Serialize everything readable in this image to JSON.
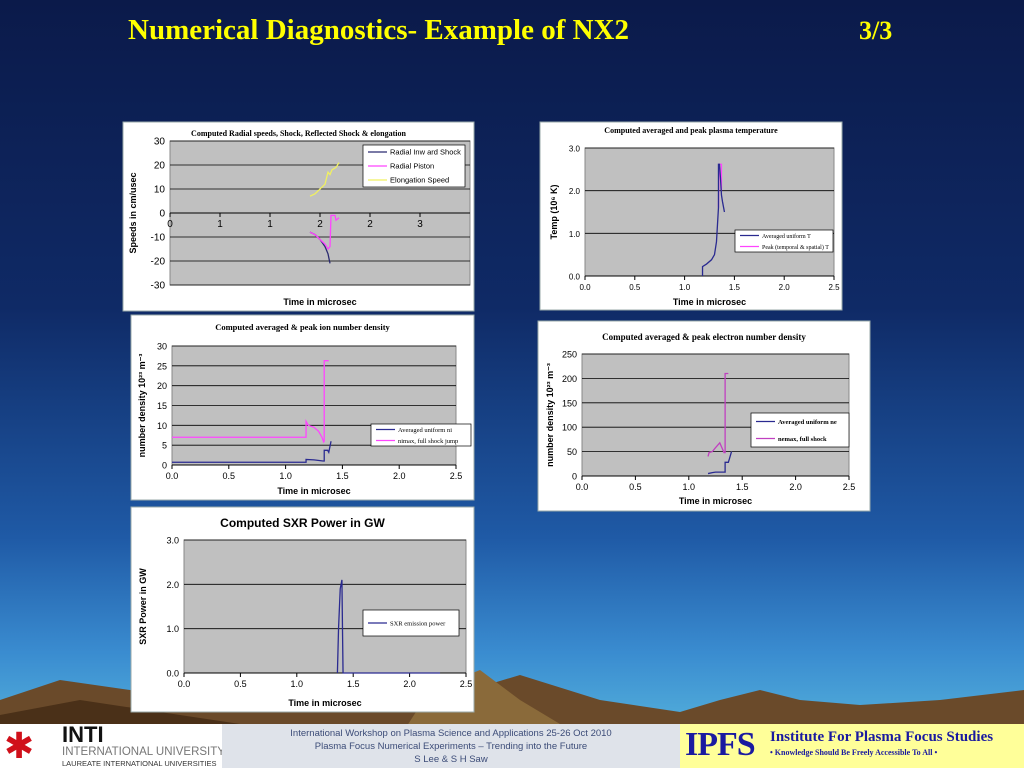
{
  "slide": {
    "title": "Numerical Diagnostics- Example of NX2",
    "page": "3/3"
  },
  "footer": {
    "inti_logo": "INTI",
    "inti_line2": "INTERNATIONAL UNIVERSITY",
    "inti_line3": "LAUREATE INTERNATIONAL UNIVERSITIES",
    "conf_line1": "International Workshop on Plasma Science and Applications 25-26 Oct 2010",
    "conf_line2": "Plasma Focus Numerical Experiments – Trending into the Future",
    "conf_line3": "S Lee & S H Saw",
    "ipfs_logo": "IPFS",
    "ipfs_name": "Institute For Plasma Focus Studies",
    "ipfs_tagline": "• Knowledge Should Be Freely Accessible To All •"
  },
  "colors": {
    "plot_bg": "#c0c0c0",
    "navy": "#2a2a80",
    "magenta": "#ff44ff",
    "yellow": "#f0f060"
  },
  "chart_data": [
    {
      "type": "line",
      "title": "Computed Radial speeds, Shock, Reflected Shock & elongation",
      "xlabel": "Time in microsec",
      "ylabel": "Speeds in cm/usec",
      "xlim": [
        0,
        3
      ],
      "ylim": [
        -30,
        30
      ],
      "xticks": [
        0,
        0.5,
        1,
        1.5,
        2,
        2.5,
        3
      ],
      "xtick_labels": [
        "0",
        "1",
        "1",
        "2",
        "2",
        "3"
      ],
      "yticks": [
        30,
        20,
        10,
        0,
        -10,
        -20,
        -30
      ],
      "ytick_labels": [
        "30",
        "20",
        "10",
        "0",
        "-10",
        "-20",
        "-30"
      ],
      "grid": true,
      "legend": "top-right",
      "x_axis_at_zero": true,
      "series": [
        {
          "name": "Radial Inw ard Shock",
          "color": "#2a2a70",
          "x": [
            1.4,
            1.45,
            1.5,
            1.55,
            1.58,
            1.59,
            1.6
          ],
          "y": [
            -8,
            -9,
            -11,
            -14,
            -17,
            -19,
            -21
          ]
        },
        {
          "name": "Radial Piston",
          "color": "#ff44ff",
          "x": [
            1.4,
            1.45,
            1.5,
            1.55,
            1.58,
            1.6,
            1.61,
            1.65,
            1.66,
            1.69
          ],
          "y": [
            -8,
            -9,
            -11,
            -13,
            -15,
            -14,
            -1,
            -1,
            -3,
            -2
          ]
        },
        {
          "name": "Elongation Speed",
          "color": "#f0f060",
          "x": [
            1.4,
            1.45,
            1.5,
            1.55,
            1.58,
            1.6,
            1.62,
            1.66,
            1.69
          ],
          "y": [
            7,
            8,
            10,
            12,
            17,
            16,
            18,
            19,
            21
          ]
        }
      ]
    },
    {
      "type": "line",
      "title": "Computed averaged and peak plasma temperature",
      "xlabel": "Time in microsec",
      "ylabel": "Temp (10⁶ K)",
      "xlim": [
        0,
        2.5
      ],
      "ylim": [
        0,
        3
      ],
      "xticks": [
        0,
        0.5,
        1,
        1.5,
        2,
        2.5
      ],
      "xtick_labels": [
        "0.0",
        "0.5",
        "1.0",
        "1.5",
        "2.0",
        "2.5"
      ],
      "yticks": [
        3,
        2,
        1,
        0
      ],
      "ytick_labels": [
        "3.0",
        "2.0",
        "1.0",
        "0.0"
      ],
      "grid": true,
      "legend": "right",
      "series": [
        {
          "name": "Peak (temporal & spatial) T",
          "color": "#ff44ff",
          "x": [
            1.34,
            1.345,
            1.37,
            1.37
          ],
          "y": [
            1.6,
            2.62,
            2.62,
            2.0
          ]
        },
        {
          "name": "Averaged uniform T",
          "color": "#2a2a90",
          "x": [
            1.18,
            1.18,
            1.22,
            1.27,
            1.3,
            1.32,
            1.33,
            1.34,
            1.34,
            1.345,
            1.35,
            1.36,
            1.37,
            1.38,
            1.4
          ],
          "y": [
            0,
            0.22,
            0.28,
            0.38,
            0.5,
            0.8,
            1.2,
            1.6,
            2.62,
            2.62,
            2.62,
            2.3,
            1.9,
            1.75,
            1.5
          ]
        }
      ]
    },
    {
      "type": "line",
      "title": "Computed averaged & peak ion number density",
      "xlabel": "Time in microsec",
      "ylabel": "number density 10²³ m⁻³",
      "xlim": [
        0,
        2.5
      ],
      "ylim": [
        0,
        30
      ],
      "xticks": [
        0,
        0.5,
        1,
        1.5,
        2,
        2.5
      ],
      "xtick_labels": [
        "0.0",
        "0.5",
        "1.0",
        "1.5",
        "2.0",
        "2.5"
      ],
      "yticks": [
        30,
        25,
        20,
        15,
        10,
        5,
        0
      ],
      "ytick_labels": [
        "30",
        "25",
        "20",
        "15",
        "10",
        "5",
        "0"
      ],
      "grid": true,
      "legend": "right",
      "series": [
        {
          "name": "Averaged uniform ni",
          "color": "#2a2a90",
          "x": [
            0,
            1.18,
            1.18,
            1.25,
            1.33,
            1.34,
            1.34,
            1.37,
            1.38,
            1.4
          ],
          "y": [
            0.7,
            0.7,
            1.4,
            1.3,
            1.0,
            1.0,
            3.7,
            3.7,
            3.2,
            6
          ]
        },
        {
          "name": "nimax, full shock jump",
          "color": "#ff44ff",
          "x": [
            0,
            1.18,
            1.18,
            1.2,
            1.25,
            1.29,
            1.32,
            1.335,
            1.34,
            1.34,
            1.38
          ],
          "y": [
            7,
            7,
            11,
            10,
            9.5,
            8.5,
            7,
            5.8,
            6,
            26.3,
            26.3
          ]
        }
      ]
    },
    {
      "type": "line",
      "title": "Computed averaged & peak electron number density",
      "xlabel": "Time in microsec",
      "ylabel": "number density 10²³ m⁻³",
      "xlim": [
        0,
        2.5
      ],
      "ylim": [
        0,
        250
      ],
      "xticks": [
        0,
        0.5,
        1,
        1.5,
        2,
        2.5
      ],
      "xtick_labels": [
        "0.0",
        "0.5",
        "1.0",
        "1.5",
        "2.0",
        "2.5"
      ],
      "yticks": [
        250,
        200,
        150,
        100,
        50,
        0
      ],
      "ytick_labels": [
        "250",
        "200",
        "150",
        "100",
        "50",
        "0"
      ],
      "grid": true,
      "legend": "right",
      "series": [
        {
          "name": "Averaged uniform ne",
          "color": "#2a2a90",
          "x": [
            1.18,
            1.22,
            1.25,
            1.33,
            1.34,
            1.34,
            1.37,
            1.38,
            1.4
          ],
          "y": [
            5,
            7,
            8,
            8,
            8,
            28,
            28,
            35,
            50
          ]
        },
        {
          "name": "nemax, full shock",
          "color": "#c040c0",
          "x": [
            1.18,
            1.19,
            1.22,
            1.25,
            1.29,
            1.33,
            1.34,
            1.34,
            1.37
          ],
          "y": [
            40,
            48,
            50,
            58,
            68,
            48,
            48,
            210,
            210
          ]
        }
      ]
    },
    {
      "type": "line",
      "title": "Computed SXR Power in GW",
      "xlabel": "Time in microsec",
      "ylabel": "SXR Power in GW",
      "xlim": [
        0,
        2.5
      ],
      "ylim": [
        0,
        3
      ],
      "xticks": [
        0,
        0.5,
        1,
        1.5,
        2,
        2.5
      ],
      "xtick_labels": [
        "0.0",
        "0.5",
        "1.0",
        "1.5",
        "2.0",
        "2.5"
      ],
      "yticks": [
        3,
        2,
        1,
        0
      ],
      "ytick_labels": [
        "3.0",
        "2.0",
        "1.0",
        "0.0"
      ],
      "grid": true,
      "legend": "right",
      "series": [
        {
          "name": "SXR emission power",
          "color": "#2a2a90",
          "x": [
            1.36,
            1.37,
            1.385,
            1.4,
            1.405,
            1.41,
            2.27
          ],
          "y": [
            0,
            1.0,
            1.9,
            2.1,
            1.0,
            0,
            0
          ]
        }
      ]
    }
  ]
}
